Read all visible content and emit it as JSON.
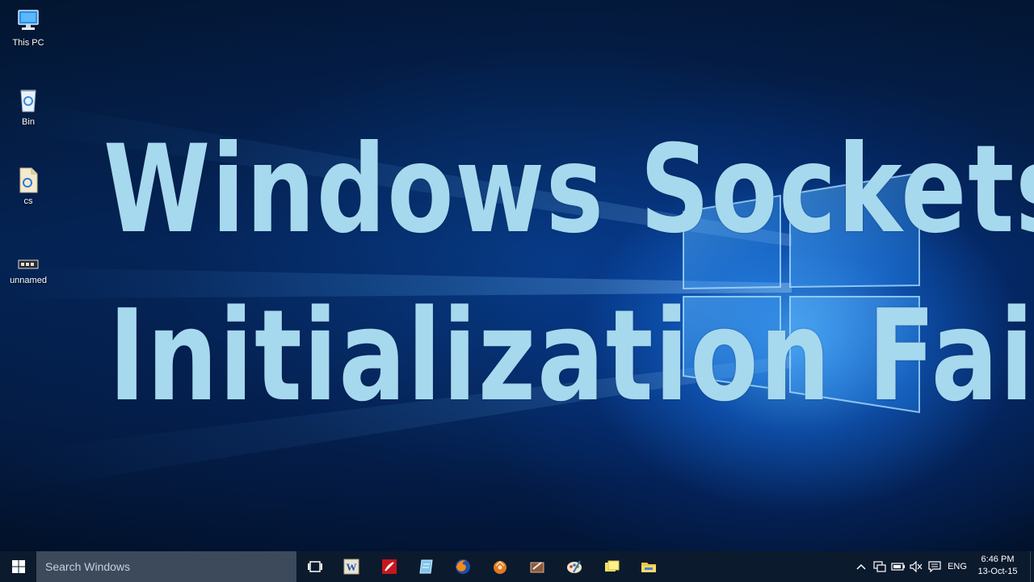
{
  "desktop": {
    "icons": [
      {
        "label": "This PC",
        "icon": "computer-icon"
      },
      {
        "label": "Bin",
        "icon": "recycle-bin-icon"
      },
      {
        "label": "cs",
        "icon": "file-icon"
      },
      {
        "label": "unnamed",
        "icon": "image-file-icon"
      }
    ]
  },
  "overlay": {
    "line1": "Windows Sockets",
    "line2": "Initialization Failed",
    "color": "#a6d8ee"
  },
  "taskbar": {
    "start_icon": "windows-logo-icon",
    "search_placeholder": "Search Windows",
    "apps": [
      "task-view-icon",
      "word-icon",
      "acrobat-icon",
      "notepad-icon",
      "firefox-icon",
      "bird-app-icon",
      "tool-app-icon",
      "paint-icon",
      "sticky-notes-icon",
      "file-explorer-icon"
    ],
    "tray": {
      "language": "ENG",
      "time": "6:46 PM",
      "date": "13-Oct-15"
    }
  },
  "colors": {
    "taskbar": "#0b1a2d",
    "search_box": "#3c4a5c",
    "accent_blue": "#1e90ff"
  }
}
